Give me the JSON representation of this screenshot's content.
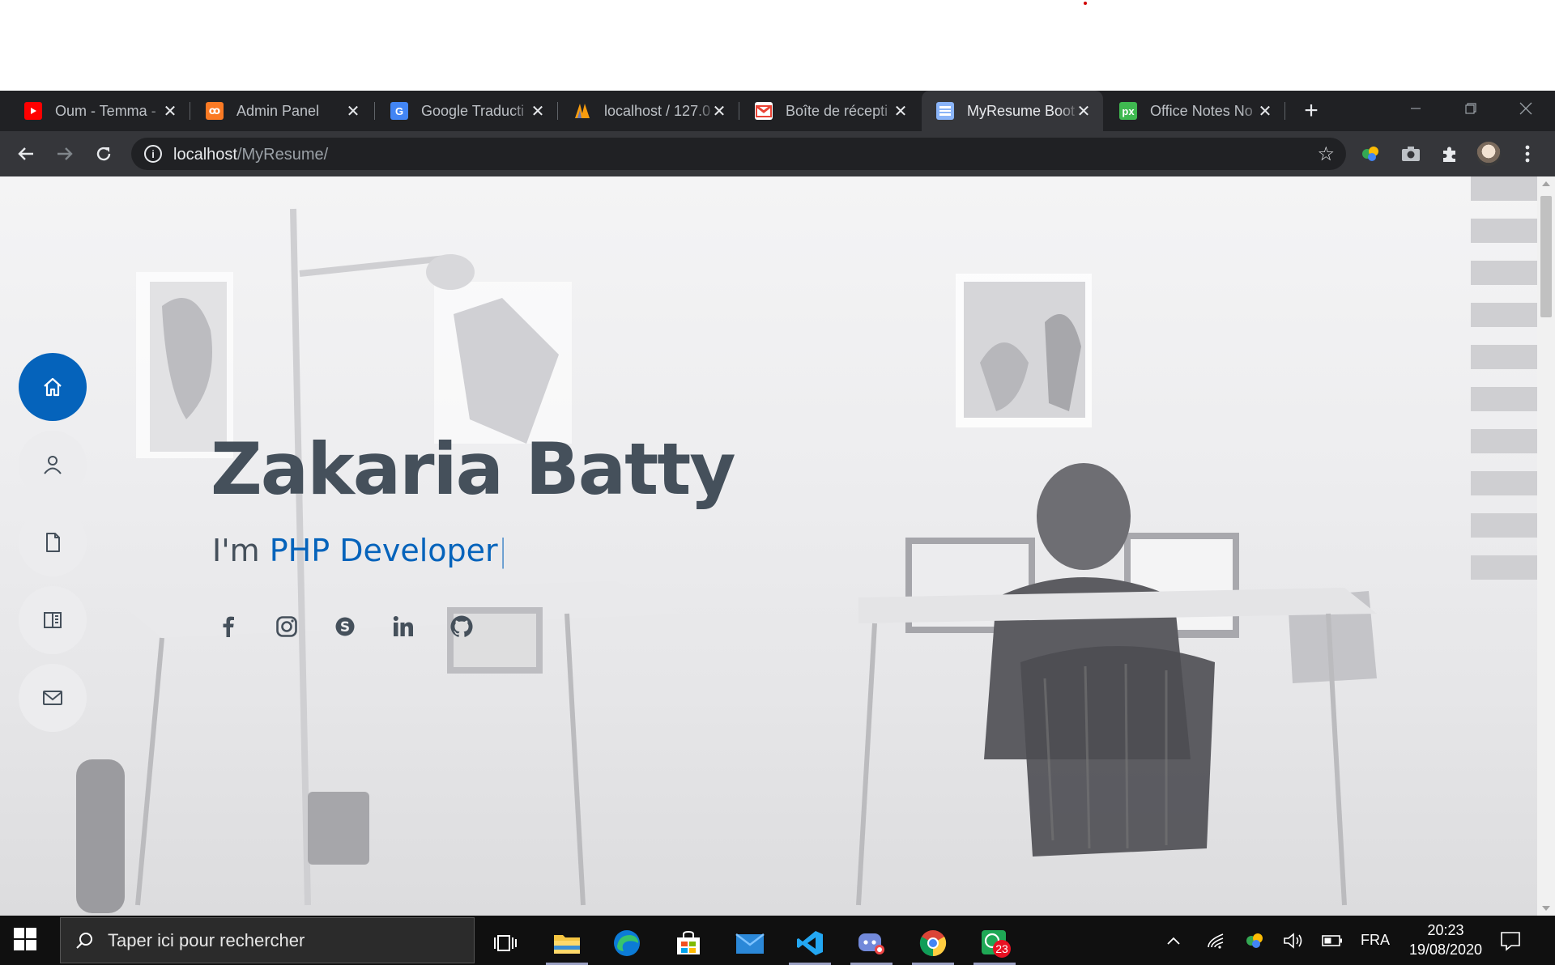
{
  "browser": {
    "tabs": [
      {
        "title": "Oum - Temma - ",
        "icon": "youtube-icon",
        "color": "#ff0000"
      },
      {
        "title": "Admin Panel",
        "icon": "xampp-icon",
        "color": "#fb7a24"
      },
      {
        "title": "Google Traducti",
        "icon": "google-translate-icon",
        "color": "#4285f4"
      },
      {
        "title": "localhost / 127.0",
        "icon": "phpmyadmin-icon",
        "color": "#f89c0e"
      },
      {
        "title": "Boîte de récepti",
        "icon": "gmail-icon",
        "color": "#ea4335"
      },
      {
        "title": "MyResume Boot",
        "icon": "site-favicon-icon",
        "color": "#8ab4f8",
        "active": true
      },
      {
        "title": "Office Notes No",
        "icon": "px-icon",
        "color": "#3fb950"
      }
    ],
    "address": {
      "host": "localhost",
      "path": "/MyResume/"
    }
  },
  "page": {
    "name": "Zakaria Batty",
    "intro_prefix": "I'm ",
    "role": "PHP Developer",
    "cursor": "|",
    "nav": [
      {
        "name": "home",
        "icon": "home-icon",
        "active": true
      },
      {
        "name": "about",
        "icon": "person-icon"
      },
      {
        "name": "resume",
        "icon": "file-icon"
      },
      {
        "name": "portfolio",
        "icon": "book-icon"
      },
      {
        "name": "contact",
        "icon": "envelope-icon"
      }
    ],
    "socials": [
      "facebook-icon",
      "instagram-icon",
      "skype-icon",
      "linkedin-icon",
      "github-icon"
    ],
    "accent": "#0563bb",
    "text_color": "#45505b"
  },
  "taskbar": {
    "search_placeholder": "Taper ici pour rechercher",
    "apps": [
      "task-view-icon",
      "file-explorer-icon",
      "edge-icon",
      "store-icon",
      "mail-icon",
      "vscode-icon",
      "discord-icon",
      "chrome-icon",
      "whatsapp-icon"
    ],
    "whatsapp_badge": "23",
    "language": "FRA",
    "time": "20:23",
    "date": "19/08/2020"
  }
}
